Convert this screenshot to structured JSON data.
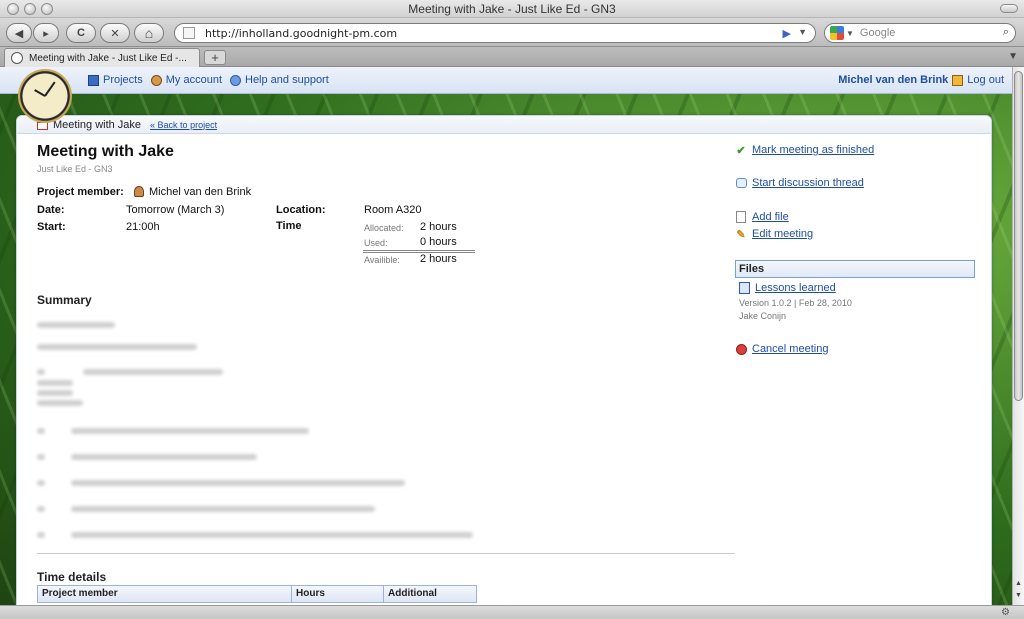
{
  "window": {
    "title": "Meeting with Jake - Just Like Ed - GN3"
  },
  "toolbar": {
    "back_glyph": "◀",
    "forward_glyph": "▸",
    "reload_glyph": "C",
    "stop_glyph": "✕",
    "home_glyph": "⌂",
    "url": "http://inholland.goodnight-pm.com",
    "go_glyph": "▶",
    "url_dropdown_glyph": "▼",
    "search_placeholder": "Google",
    "search_dropdown_glyph": "▼",
    "search_glyph": "⌕"
  },
  "tabbar": {
    "tabs": [
      {
        "label": "Meeting with Jake - Just Like Ed -..."
      }
    ],
    "new_tab_glyph": "+",
    "menu_glyph": "▼"
  },
  "app_nav": {
    "links": [
      {
        "label": "Projects",
        "icon": "projects-icon"
      },
      {
        "label": "My account",
        "icon": "account-icon"
      },
      {
        "label": "Help and support",
        "icon": "help-icon"
      }
    ],
    "user_name": "Michel van den Brink",
    "logout_label": "Log out"
  },
  "breadcrumb": {
    "title": "Meeting with Jake",
    "back_link": "« Back to project"
  },
  "meeting": {
    "title": "Meeting with Jake",
    "subtitle": "Just Like Ed - GN3",
    "project_member_label": "Project member:",
    "project_member": "Michel van den Brink",
    "date_label": "Date:",
    "date": "Tomorrow (March 3)",
    "start_label": "Start:",
    "start": "21:00h",
    "location_label": "Location:",
    "location": "Room A320",
    "time_label": "Time",
    "time": {
      "allocated_label": "Allocated:",
      "allocated": "2 hours",
      "used_label": "Used:",
      "used": "0 hours",
      "available_label": "Availible:",
      "available": "2 hours"
    }
  },
  "summary": {
    "title": "Summary"
  },
  "time_details": {
    "title": "Time details",
    "columns": [
      "Project member",
      "Hours",
      "Additional"
    ]
  },
  "actions": {
    "mark_finished": "Mark meeting as finished",
    "start_discussion": "Start discussion thread",
    "add_file": "Add file",
    "edit_meeting": "Edit meeting",
    "cancel_meeting": "Cancel meeting"
  },
  "files": {
    "header": "Files",
    "items": [
      {
        "name": "Lessons learned",
        "version": "Version 1.0.2 | Feb 28, 2010",
        "author": "Jake Conijn"
      }
    ]
  },
  "scrollbar": {
    "up_glyph": "▲",
    "down_glyph": "▼"
  },
  "status": {
    "icon_glyph": "⚙"
  },
  "colors": {
    "link": "#1f4ea0",
    "accent_blue": "#7b9fd0",
    "success": "#3b9a2c",
    "danger": "#d8413b"
  }
}
